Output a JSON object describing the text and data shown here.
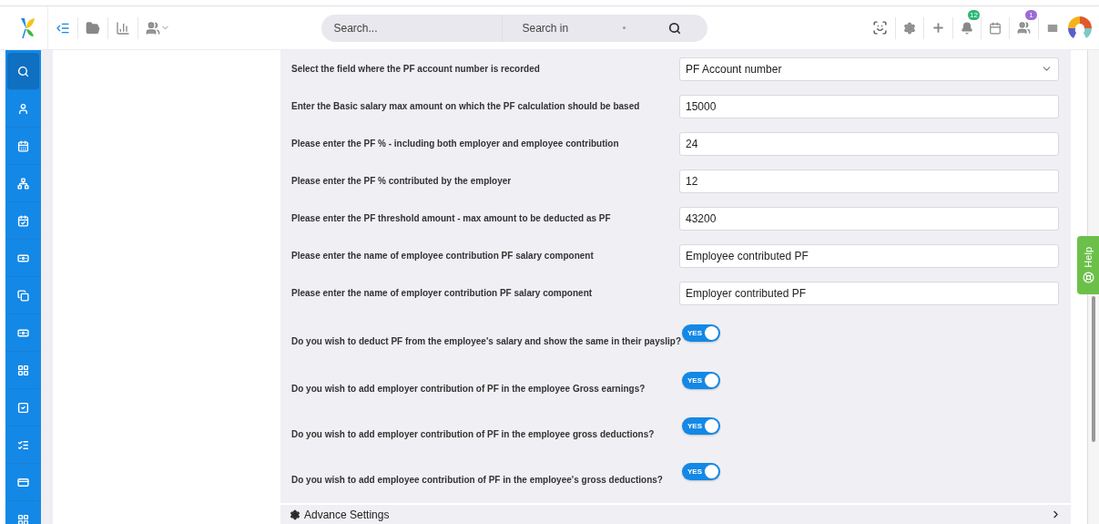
{
  "topbar": {
    "search": {
      "placeholder": "Search..."
    },
    "search_scope": {
      "value": "Search in"
    },
    "notifications_badge": "12",
    "team_badge": "1"
  },
  "sidebar": {
    "items": [
      {
        "selected": true
      },
      {
        "selected": false
      },
      {
        "selected": false
      },
      {
        "selected": false
      },
      {
        "selected": false
      },
      {
        "selected": false
      },
      {
        "selected": false
      },
      {
        "selected": false
      },
      {
        "selected": false
      },
      {
        "selected": false
      },
      {
        "selected": false
      },
      {
        "selected": false
      },
      {
        "selected": false
      }
    ]
  },
  "settings": [
    {
      "kind": "select",
      "label": "Select the field where the PF account number is recorded",
      "value": "PF Account number"
    },
    {
      "kind": "field",
      "label": "Enter the Basic salary max amount on which the PF calculation should be based",
      "value": "15000"
    },
    {
      "kind": "field",
      "label": "Please enter the PF % - including both employer and employee contribution",
      "value": "24"
    },
    {
      "kind": "field",
      "label": "Please enter the PF % contributed by the employer",
      "value": "12"
    },
    {
      "kind": "field",
      "label": "Please enter the PF threshold amount - max amount to be deducted as PF",
      "value": "43200"
    },
    {
      "kind": "field",
      "label": "Please enter the name of employee contribution PF salary component",
      "value": "Employee contributed PF"
    },
    {
      "kind": "field",
      "label": "Please enter the name of employer contribution PF salary component",
      "value": "Employer contributed PF"
    },
    {
      "kind": "toggle",
      "label": "Do you wish to deduct PF from the employee's salary and show the same in their payslip?",
      "on": true,
      "text": "YES"
    },
    {
      "kind": "toggle",
      "label": "Do you wish to add employer contribution of PF in the employee Gross earnings?",
      "on": true,
      "text": "YES"
    },
    {
      "kind": "toggle",
      "label": "Do you wish to add employer contribution of PF in the employee gross deductions?",
      "on": true,
      "text": "YES"
    },
    {
      "kind": "toggle",
      "label": "Do you wish to add employee contribution of PF in the employee's gross deductions?",
      "on": true,
      "text": "YES"
    }
  ],
  "advance_settings": {
    "title": "Advance Settings",
    "expanded": false
  },
  "help_tab": "Help"
}
